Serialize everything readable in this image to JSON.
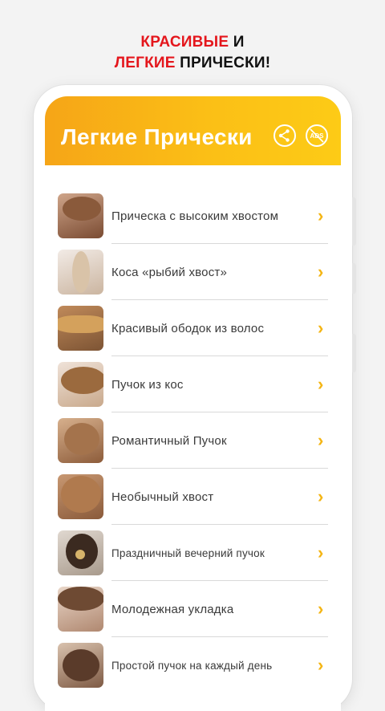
{
  "promo": {
    "line1_red": "КРАСИВЫЕ",
    "line1_black": " И",
    "line2_red": "ЛЕГКИЕ",
    "line2_black": " ПРИЧЕСКИ!"
  },
  "header": {
    "title": "Легкие Прически",
    "share_icon": "share-icon",
    "ads_icon": "no-ads-icon",
    "ads_text": "ADS"
  },
  "colors": {
    "accent": "#fbbf16",
    "promo_red": "#e4161c",
    "chevron": "#f4b514"
  },
  "items": [
    {
      "label": "Прическа с высоким хвостом",
      "hair": "#8a5a3b"
    },
    {
      "label": "Коса «рыбий хвост»",
      "hair": "#d9c3a8"
    },
    {
      "label": "Красивый ободок из волос",
      "hair": "#a87a48"
    },
    {
      "label": "Пучок из кос",
      "hair": "#9b6a3e"
    },
    {
      "label": "Романтичный Пучок",
      "hair": "#a4734c"
    },
    {
      "label": "Необычный хвост",
      "hair": "#b07a4e"
    },
    {
      "label": "Праздничный вечерний пучок",
      "hair": "#3b2a20"
    },
    {
      "label": "Молодежная укладка",
      "hair": "#6e4a33"
    },
    {
      "label": "Простой пучок на каждый день",
      "hair": "#5a3b2a"
    }
  ]
}
